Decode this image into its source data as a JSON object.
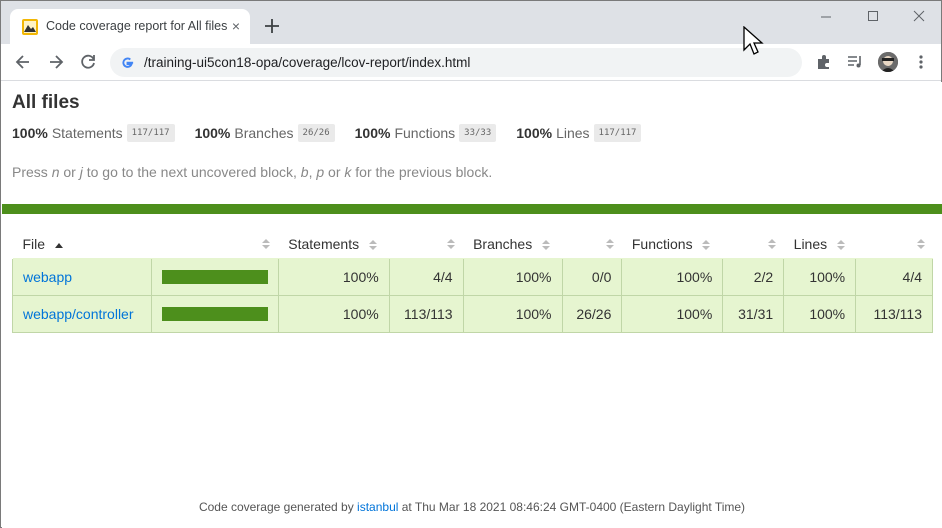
{
  "browser": {
    "tab_title": "Code coverage report for All files",
    "tab_close_glyph": "×",
    "url": "/training-ui5con18-opa/coverage/lcov-report/index.html",
    "icons": [
      "favicon-icon",
      "new-tab-icon",
      "minimize-icon",
      "maximize-icon",
      "close-window-icon",
      "back-icon",
      "forward-icon",
      "reload-icon",
      "google-icon",
      "extensions-icon",
      "media-icon",
      "avatar",
      "menu-icon"
    ]
  },
  "report": {
    "title": "All files",
    "summary": [
      {
        "pct": "100%",
        "metric": "Statements",
        "fraction": "117/117"
      },
      {
        "pct": "100%",
        "metric": "Branches",
        "fraction": "26/26"
      },
      {
        "pct": "100%",
        "metric": "Functions",
        "fraction": "33/33"
      },
      {
        "pct": "100%",
        "metric": "Lines",
        "fraction": "117/117"
      }
    ],
    "hint": {
      "part1": "Press ",
      "key1": "n",
      "part2": " or ",
      "key2": "j",
      "part3": " to go to the next uncovered block, ",
      "key3": "b",
      "part4": ", ",
      "key4": "p",
      "part5": " or ",
      "key5": "k",
      "part6": " for the previous block."
    },
    "columns": {
      "file": "File",
      "statements": "Statements",
      "branches": "Branches",
      "functions": "Functions",
      "lines": "Lines"
    },
    "rows": [
      {
        "file": "webapp",
        "coverage": 1.0,
        "statements_pct": "100%",
        "statements": "4/4",
        "branches_pct": "100%",
        "branches": "0/0",
        "functions_pct": "100%",
        "functions": "2/2",
        "lines_pct": "100%",
        "lines": "4/4"
      },
      {
        "file": "webapp/controller",
        "coverage": 1.0,
        "statements_pct": "100%",
        "statements": "113/113",
        "branches_pct": "100%",
        "branches": "26/26",
        "functions_pct": "100%",
        "functions": "31/31",
        "lines_pct": "100%",
        "lines": "113/113"
      }
    ],
    "footer": {
      "prefix": "Code coverage generated by ",
      "link": "istanbul",
      "suffix": " at Thu Mar 18 2021 08:46:24 GMT-0400 (Eastern Daylight Time)"
    },
    "colors": {
      "high": "#4d8f1c",
      "row_bg": "#e6f5d0",
      "link": "#0074d9"
    }
  }
}
